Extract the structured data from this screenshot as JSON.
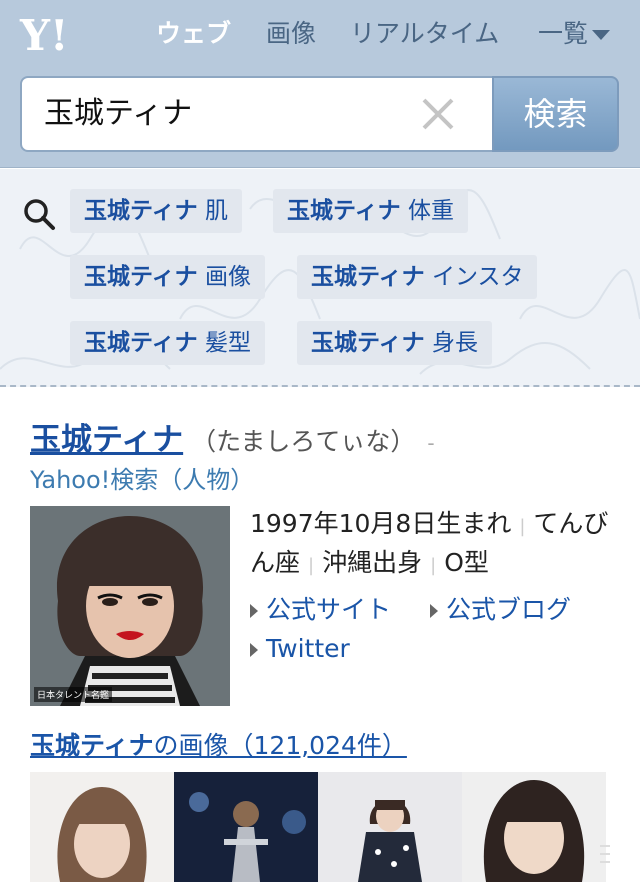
{
  "header": {
    "logo_text": "Y!",
    "nav": [
      {
        "label": "ウェブ",
        "active": true
      },
      {
        "label": "画像",
        "active": false
      },
      {
        "label": "リアルタイム",
        "active": false
      },
      {
        "label": "一覧",
        "active": false
      }
    ],
    "search": {
      "value": "玉城ティナ",
      "button_label": "検索"
    }
  },
  "suggestions": [
    {
      "name": "玉城ティナ",
      "keyword": "肌"
    },
    {
      "name": "玉城ティナ",
      "keyword": "体重"
    },
    {
      "name": "玉城ティナ",
      "keyword": "画像"
    },
    {
      "name": "玉城ティナ",
      "keyword": "インスタ"
    },
    {
      "name": "玉城ティナ",
      "keyword": "髪型"
    },
    {
      "name": "玉城ティナ",
      "keyword": "身長"
    }
  ],
  "result": {
    "title": "玉城ティナ",
    "reading": "（たましろてぃな）",
    "dash": "-",
    "source": "Yahoo!検索（人物）",
    "portrait_credit": "日本タレント名鑑",
    "birth": "1997年10月8日生まれ",
    "sign": "てんびん座",
    "birthplace": "沖縄出身",
    "blood": "O型",
    "links": [
      "公式サイト",
      "公式ブログ",
      "Twitter"
    ],
    "images_name": "玉城ティナ",
    "images_text": "の画像（121,024件）"
  },
  "colors": {
    "header_bg": "#b7c9dc",
    "link": "#1a55a8",
    "chip_bg": "#e2e7ee"
  }
}
